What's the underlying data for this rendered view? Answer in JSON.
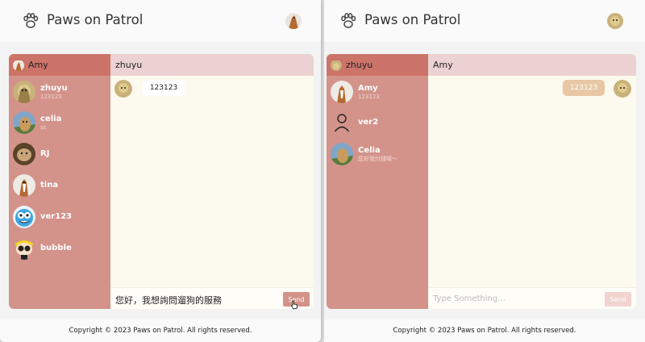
{
  "brand": "Paws on Patrol",
  "footer": "Copyright © 2023 Paws on Patrol. All rights reserved.",
  "colors": {
    "sidebar": "#d3938a",
    "sidebar_header": "#cc7469",
    "chat_header": "#ecd2d2",
    "chat_bg": "#fcf9ef",
    "accent": "#e8c7a4"
  },
  "left_window": {
    "current_user": "Amy",
    "chat_with": "zhuyu",
    "contacts": [
      {
        "name": "zhuyu",
        "preview": "123123"
      },
      {
        "name": "celia",
        "preview": "ss"
      },
      {
        "name": "RJ",
        "preview": ""
      },
      {
        "name": "tina",
        "preview": ""
      },
      {
        "name": "ver123",
        "preview": ""
      },
      {
        "name": "bubble",
        "preview": ""
      }
    ],
    "messages": [
      {
        "from": "zhuyu",
        "text": "123123"
      }
    ],
    "input_value": "您好，我想詢問遛狗的服務",
    "send_label": "Send"
  },
  "right_window": {
    "current_user": "zhuyu",
    "chat_with": "Amy",
    "contacts": [
      {
        "name": "Amy",
        "preview": "123123"
      },
      {
        "name": "ver2",
        "preview": ""
      },
      {
        "name": "Celia",
        "preview": "您好我付錢囉～"
      }
    ],
    "messages": [
      {
        "from": "me",
        "text": "123123"
      }
    ],
    "input_placeholder": "Type Something...",
    "send_label": "Send"
  }
}
